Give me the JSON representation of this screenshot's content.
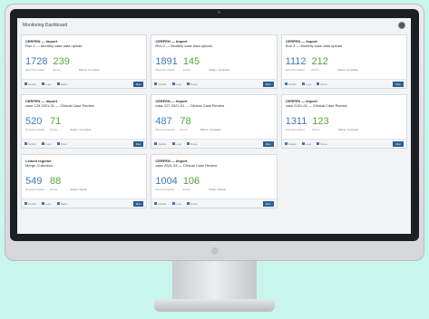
{
  "header": {
    "title": "Monitoring Dashboard"
  },
  "cards": [
    {
      "type": "CERFEN — Import",
      "title": "Run 1 — Monthly case data upload",
      "count1": "1728",
      "count2": "239",
      "sub1": "Records loaded",
      "sub2": "Errors",
      "meta": "Status: Complete",
      "f1": "Details",
      "f2": "Logs",
      "f3": "Rules",
      "action": "Run"
    },
    {
      "type": "CERFEN — Import",
      "title": "Run 2 — Monthly case data upload",
      "count1": "1891",
      "count2": "145",
      "sub1": "Records loaded",
      "sub2": "Errors",
      "meta": "Status: Complete",
      "f1": "Details",
      "f2": "Logs",
      "f3": "Rules",
      "action": "Run"
    },
    {
      "type": "CERFEN — Import",
      "title": "Run 3 — Monthly case data upload",
      "count1": "1112",
      "count2": "212",
      "sub1": "Records loaded",
      "sub2": "Errors",
      "meta": "Status: Complete",
      "f1": "Details",
      "f2": "Logs",
      "f3": "Rules",
      "action": "Run"
    },
    {
      "type": "CERFEN — Import",
      "title": "case 125 2021-01 — Clinical Case Review",
      "count1": "520",
      "count2": "71",
      "sub1": "Records loaded",
      "sub2": "Errors",
      "meta": "Status: Complete",
      "f1": "Details",
      "f2": "Logs",
      "f3": "Rules",
      "action": "Run"
    },
    {
      "type": "CERFEN — Import",
      "title": "case 127 2021-01 — Clinical Case Review",
      "count1": "487",
      "count2": "78",
      "sub1": "Records loaded",
      "sub2": "Errors",
      "meta": "Status: Complete",
      "f1": "Details",
      "f2": "Logs",
      "f3": "Rules",
      "action": "Run"
    },
    {
      "type": "CERFEN — Import",
      "title": "case 2021-01 — Clinical Case Review",
      "count1": "1311",
      "count2": "123",
      "sub1": "Records loaded",
      "sub2": "Errors",
      "meta": "Status: Complete",
      "f1": "Details",
      "f2": "Logs",
      "f3": "Rules",
      "action": "Run"
    },
    {
      "type": "Linked register",
      "title": "Merge Collection",
      "count1": "549",
      "count2": "88",
      "sub1": "Records loaded",
      "sub2": "Errors",
      "meta": "Status: Ready",
      "f1": "Details",
      "f2": "Logs",
      "f3": "Rules",
      "action": "Run"
    },
    {
      "type": "CERFEN — Import",
      "title": "case 2021-01 — Clinical Case Review",
      "count1": "1004",
      "count2": "106",
      "sub1": "Records loaded",
      "sub2": "Errors",
      "meta": "Status: Ready",
      "f1": "Details",
      "f2": "Logs",
      "f3": "Rules",
      "action": "Run"
    }
  ],
  "colors": {
    "accent_blue": "#3e79b8",
    "accent_green": "#5aa33a",
    "background": "#c8f6ec"
  },
  "icons": {
    "settings": "gear-icon"
  }
}
